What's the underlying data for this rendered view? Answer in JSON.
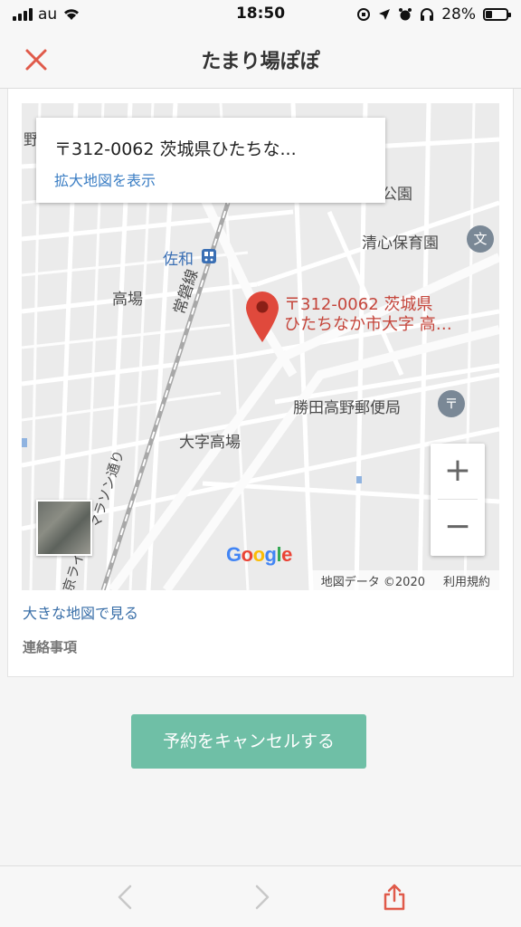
{
  "status_bar": {
    "carrier": "au",
    "time": "18:50",
    "battery_percent": "28%",
    "battery_level": 0.28
  },
  "header": {
    "title": "たまり場ぽぽ",
    "close_icon": "close-icon",
    "accent_color": "#e05a4a"
  },
  "map": {
    "info_box": {
      "address": "〒312-0062 茨城県ひたちな...",
      "link": "拡大地図を表示"
    },
    "pin_label_line1": "〒312-0062 茨城県",
    "pin_label_line2": "ひたちなか市大字 高…",
    "places": {
      "station": "佐和",
      "school": "清心保育園",
      "post_office": "勝田高野郵便局",
      "area_takaba": "高場",
      "area_oaza": "大字高場",
      "rail_line": "常磐線",
      "marathon_road": "マラソン通り",
      "partial_top": "野",
      "partial_park": "公園",
      "partial_line": "京ライン"
    },
    "school_icon_glyph": "文",
    "zoom_in": "+",
    "zoom_out": "−",
    "google_logo": "Google",
    "map_data": "地図データ ©2020",
    "terms": "利用規約"
  },
  "links": {
    "big_map": "大きな地図で見る"
  },
  "contact_label": "連絡事項",
  "cancel_button": {
    "label": "予約をキャンセルする",
    "color": "#6fbfa6"
  },
  "toolbar": {
    "back_icon": "chevron-left-icon",
    "forward_icon": "chevron-right-icon",
    "share_icon": "share-icon"
  }
}
